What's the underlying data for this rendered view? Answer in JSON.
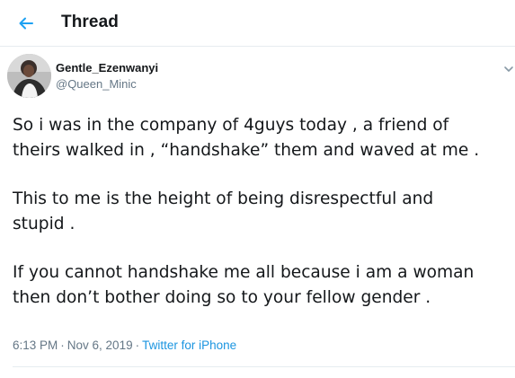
{
  "header": {
    "title": "Thread",
    "back_icon": "arrow-left-icon",
    "accent_color": "#1da1f2"
  },
  "tweet": {
    "author": {
      "display_name": "Gentle_Ezenwanyi",
      "handle": "@Queen_Minic"
    },
    "paragraphs": [
      {
        "line1": "So i was in the company of 4guys today , a friend of",
        "line2": "theirs walked in , “handshake” them and waved at me ."
      },
      {
        "line1": "This to me is the height of being disrespectful and",
        "line2": "stupid ."
      },
      {
        "line1": "If you cannot handshake me all because i am a woman",
        "line2": "then don’t bother doing so to your fellow gender ."
      }
    ],
    "time": "6:13 PM",
    "date": "Nov 6, 2019",
    "separator": "·",
    "source": "Twitter for iPhone",
    "menu_icon": "chevron-down-icon"
  },
  "colors": {
    "text": "#14171a",
    "secondary": "#657786",
    "link": "#1b95e0",
    "divider": "#e6ecf0"
  }
}
